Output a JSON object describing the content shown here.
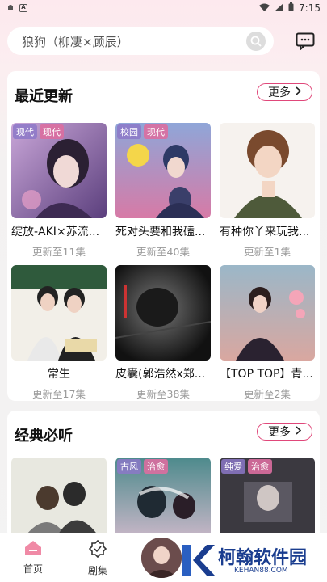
{
  "status": {
    "time": "7:15"
  },
  "search": {
    "text": "狼狗（柳凄×顾辰）"
  },
  "recent": {
    "title": "最近更新",
    "more": "更多",
    "items": [
      {
        "title": "绽放-AKI×苏流...",
        "sub": "更新至11集",
        "tags": [
          "现代",
          "现代"
        ]
      },
      {
        "title": "死对头要和我磕...",
        "sub": "更新至40集",
        "tags": [
          "校园",
          "现代"
        ]
      },
      {
        "title": "有种你丫来玩我...",
        "sub": "更新至1集",
        "tags": []
      },
      {
        "title": "常生",
        "sub": "更新至17集",
        "tags": []
      },
      {
        "title": "皮囊(郭浩然x郑...",
        "sub": "更新至38集",
        "tags": []
      },
      {
        "title": "【TOP TOP】青...",
        "sub": "更新至2集",
        "tags": []
      }
    ]
  },
  "classic": {
    "title": "经典必听",
    "more": "更多",
    "items": [
      {
        "tags": []
      },
      {
        "tags": [
          "古风",
          "治愈"
        ]
      },
      {
        "tags": [
          "纯爱",
          "治愈"
        ]
      }
    ]
  },
  "nav": {
    "home": "首页",
    "drama": "剧集"
  },
  "watermark": {
    "brand": "柯翰软件园",
    "url": "KEHAN88.COM"
  },
  "colors": {
    "accent": "#e0477a",
    "brand": "#1a3d8f"
  }
}
